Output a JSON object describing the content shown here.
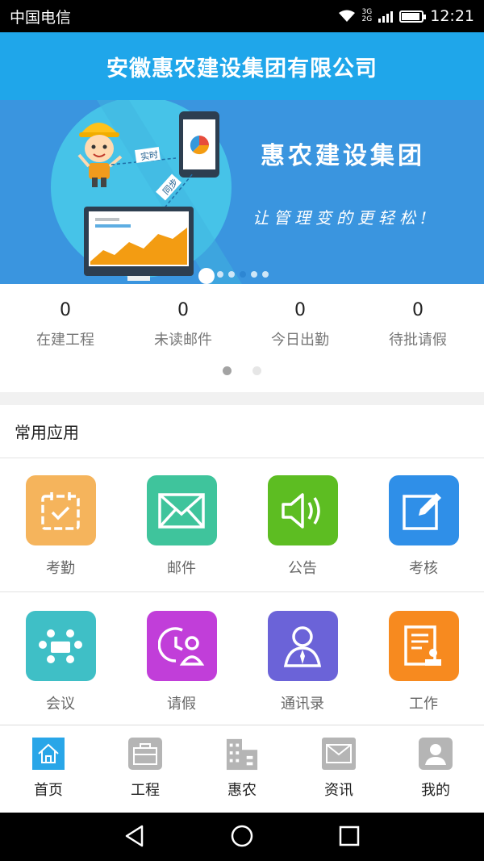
{
  "status_bar": {
    "carrier": "中国电信",
    "net_top": "3G",
    "net_bottom": "2G",
    "time": "12:21"
  },
  "header": {
    "title": "安徽惠农建设集团有限公司"
  },
  "banner": {
    "title": "惠农建设集团",
    "slogan": "让管理变的更轻松!",
    "tag_realtime": "实时",
    "tag_sync": "同步",
    "slide_count": 5,
    "active_slide": 3
  },
  "stats": [
    {
      "value": "0",
      "label": "在建工程"
    },
    {
      "value": "0",
      "label": "未读邮件"
    },
    {
      "value": "0",
      "label": "今日出勤"
    },
    {
      "value": "0",
      "label": "待批请假"
    }
  ],
  "section": {
    "title": "常用应用"
  },
  "apps": [
    {
      "label": "考勤",
      "icon": "calendar-check-icon",
      "color": "#f5b45c"
    },
    {
      "label": "邮件",
      "icon": "envelope-icon",
      "color": "#3fc49c"
    },
    {
      "label": "公告",
      "icon": "speaker-icon",
      "color": "#5dbd22"
    },
    {
      "label": "考核",
      "icon": "edit-icon",
      "color": "#2f8fe8"
    },
    {
      "label": "会议",
      "icon": "meeting-icon",
      "color": "#3fbfc6"
    },
    {
      "label": "请假",
      "icon": "clock-user-icon",
      "color": "#c13ed9"
    },
    {
      "label": "通讯录",
      "icon": "contact-icon",
      "color": "#6b63d8"
    },
    {
      "label": "工作",
      "icon": "document-stamp-icon",
      "color": "#f78a1f"
    }
  ],
  "nav": [
    {
      "label": "首页",
      "icon": "home-icon",
      "active": true
    },
    {
      "label": "工程",
      "icon": "briefcase-icon"
    },
    {
      "label": "惠农",
      "icon": "building-icon"
    },
    {
      "label": "资讯",
      "icon": "mail-icon"
    },
    {
      "label": "我的",
      "icon": "profile-icon"
    }
  ],
  "colors": {
    "header": "#1fa6ea",
    "banner": "#3a95df",
    "nav_active": "#29a6e8",
    "nav_inactive": "#b5b5b5"
  }
}
